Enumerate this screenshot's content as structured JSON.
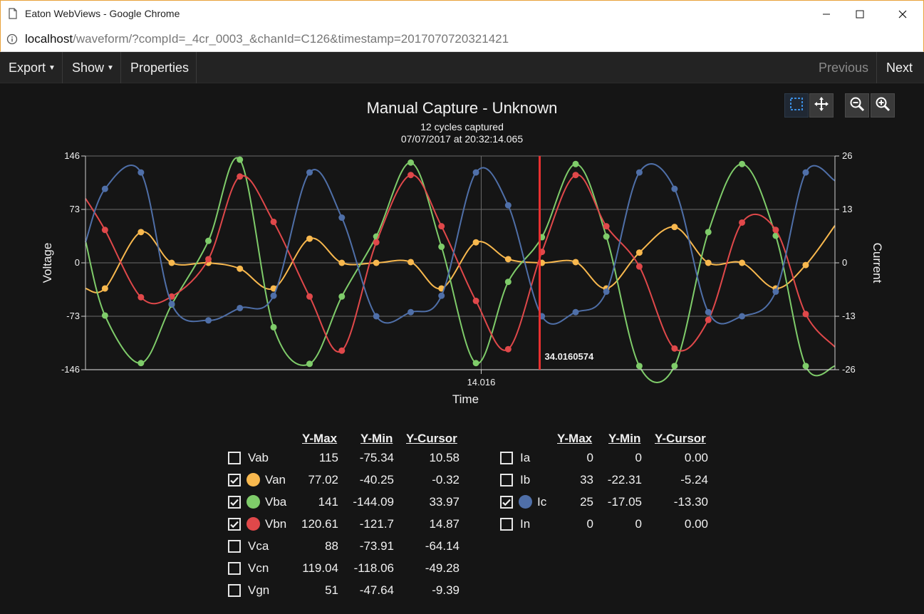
{
  "window": {
    "title": "Eaton WebViews - Google Chrome",
    "url_host": "localhost",
    "url_path": "/waveform/?compId=_4cr_0003_&chanId=C126&timestamp=20170707203214​21"
  },
  "toolbar": {
    "export_label": "Export",
    "show_label": "Show",
    "properties_label": "Properties",
    "previous_label": "Previous",
    "next_label": "Next"
  },
  "chart_header": {
    "title": "Manual Capture - Unknown",
    "subtitle": "12 cycles captured",
    "timestamp": "07/07/2017 at 20:32:14.065"
  },
  "chart_data": {
    "type": "line",
    "xlabel": "Time",
    "x_tick": "14.016",
    "ylabel_left": "Voltage",
    "ylabel_right": "Current",
    "yticks_left": [
      146,
      73,
      0,
      -73,
      -146
    ],
    "yticks_right": [
      26,
      13,
      0,
      -13,
      -26
    ],
    "ylim_left": [
      -146,
      146
    ],
    "ylim_right": [
      -26,
      26
    ],
    "grid": true,
    "cursor_label": "34.0160574",
    "series": [
      {
        "name": "Van",
        "axis": "left",
        "color": "#f8b84e",
        "x": [
          0,
          0.026,
          0.074,
          0.115,
          0.164,
          0.206,
          0.251,
          0.299,
          0.342,
          0.388,
          0.434,
          0.475,
          0.521,
          0.564,
          0.609,
          0.654,
          0.695,
          0.739,
          0.786,
          0.831,
          0.876,
          0.921,
          0.961,
          1.0
        ],
        "y": [
          -35,
          -35,
          42,
          0,
          0,
          -8,
          -35,
          33,
          0,
          0,
          1,
          -35,
          28,
          5,
          0,
          1,
          -35,
          14,
          49,
          0,
          0,
          -35,
          -3,
          51
        ]
      },
      {
        "name": "Vba",
        "axis": "left",
        "color": "#7fcc6a",
        "x": [
          0,
          0.026,
          0.074,
          0.115,
          0.164,
          0.206,
          0.251,
          0.299,
          0.342,
          0.388,
          0.434,
          0.475,
          0.521,
          0.564,
          0.609,
          0.654,
          0.695,
          0.739,
          0.786,
          0.831,
          0.876,
          0.921,
          0.961,
          1.0
        ],
        "y": [
          30,
          -72,
          -137,
          -57,
          30,
          141,
          -88,
          -138,
          -46,
          36,
          137,
          22,
          -137,
          -26,
          35,
          135,
          36,
          -141,
          -141,
          42,
          135,
          37,
          -141,
          -141
        ]
      },
      {
        "name": "Vbn",
        "axis": "left",
        "color": "#e0484a",
        "x": [
          0,
          0.026,
          0.074,
          0.115,
          0.164,
          0.206,
          0.251,
          0.299,
          0.342,
          0.388,
          0.434,
          0.475,
          0.521,
          0.564,
          0.609,
          0.654,
          0.695,
          0.739,
          0.786,
          0.831,
          0.876,
          0.921,
          0.961,
          1.0
        ],
        "y": [
          88,
          45,
          -47,
          -46,
          5,
          118,
          56,
          -46,
          -120,
          28,
          120,
          50,
          -52,
          -118,
          15,
          120,
          50,
          -5,
          -117,
          -78,
          55,
          45,
          -70,
          -115
        ]
      },
      {
        "name": "Ic",
        "axis": "right",
        "color": "#4f6fa8",
        "x": [
          0,
          0.026,
          0.074,
          0.115,
          0.164,
          0.206,
          0.251,
          0.299,
          0.342,
          0.388,
          0.434,
          0.475,
          0.521,
          0.564,
          0.609,
          0.654,
          0.695,
          0.739,
          0.786,
          0.831,
          0.876,
          0.921,
          0.961,
          1.0
        ],
        "y": [
          5,
          18,
          22,
          -10,
          -14,
          -11,
          -8,
          22,
          11,
          -13,
          -12,
          -8,
          22,
          14,
          -13,
          -12,
          -7,
          22,
          18,
          -12,
          -13,
          -7,
          22,
          20
        ]
      }
    ]
  },
  "voltage_table": {
    "headers": [
      "Y-Max",
      "Y-Min",
      "Y-Cursor"
    ],
    "rows": [
      {
        "name": "Vab",
        "checked": false,
        "color": "",
        "ymax": "115",
        "ymin": "-75.34",
        "ycursor": "10.58"
      },
      {
        "name": "Van",
        "checked": true,
        "color": "#f8b84e",
        "ymax": "77.02",
        "ymin": "-40.25",
        "ycursor": "-0.32"
      },
      {
        "name": "Vba",
        "checked": true,
        "color": "#7fcc6a",
        "ymax": "141",
        "ymin": "-144.09",
        "ycursor": "33.97"
      },
      {
        "name": "Vbn",
        "checked": true,
        "color": "#e0484a",
        "ymax": "120.61",
        "ymin": "-121.7",
        "ycursor": "14.87"
      },
      {
        "name": "Vca",
        "checked": false,
        "color": "",
        "ymax": "88",
        "ymin": "-73.91",
        "ycursor": "-64.14"
      },
      {
        "name": "Vcn",
        "checked": false,
        "color": "",
        "ymax": "119.04",
        "ymin": "-118.06",
        "ycursor": "-49.28"
      },
      {
        "name": "Vgn",
        "checked": false,
        "color": "",
        "ymax": "51",
        "ymin": "-47.64",
        "ycursor": "-9.39"
      }
    ]
  },
  "current_table": {
    "headers": [
      "Y-Max",
      "Y-Min",
      "Y-Cursor"
    ],
    "rows": [
      {
        "name": "Ia",
        "checked": false,
        "color": "",
        "ymax": "0",
        "ymin": "0",
        "ycursor": "0.00"
      },
      {
        "name": "Ib",
        "checked": false,
        "color": "",
        "ymax": "33",
        "ymin": "-22.31",
        "ycursor": "-5.24"
      },
      {
        "name": "Ic",
        "checked": true,
        "color": "#4f6fa8",
        "ymax": "25",
        "ymin": "-17.05",
        "ycursor": "-13.30"
      },
      {
        "name": "In",
        "checked": false,
        "color": "",
        "ymax": "0",
        "ymin": "0",
        "ycursor": "0.00"
      }
    ]
  }
}
